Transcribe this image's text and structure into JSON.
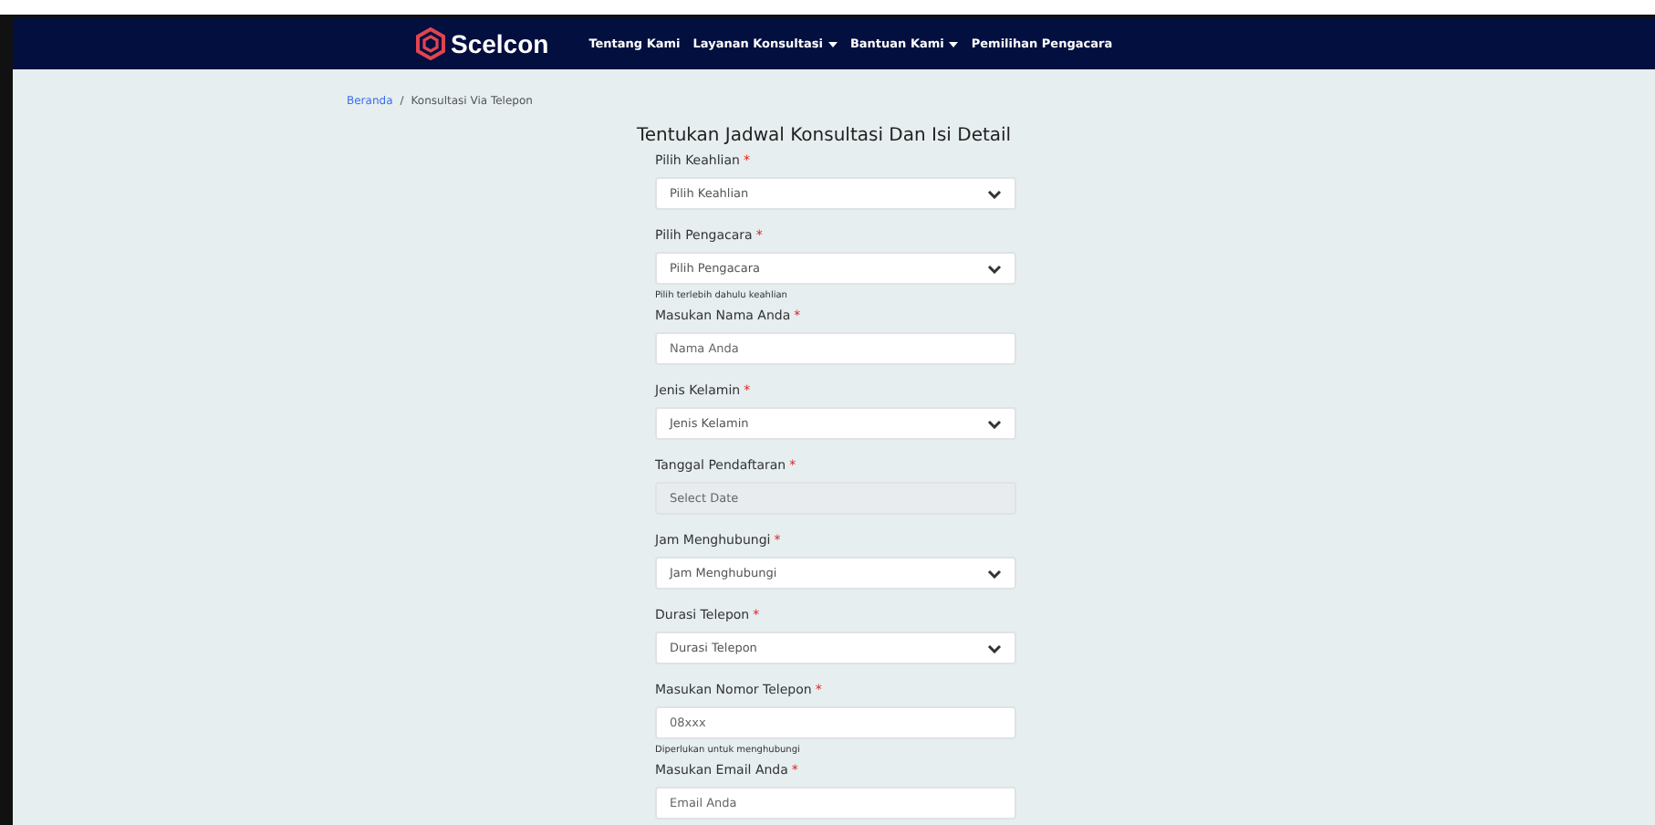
{
  "navbar": {
    "brand": "Scelcon",
    "links": [
      {
        "label": "Tentang Kami",
        "dropdown": false
      },
      {
        "label": "Layanan Konsultasi",
        "dropdown": true
      },
      {
        "label": "Bantuan Kami",
        "dropdown": true
      },
      {
        "label": "Pemilihan Pengacara",
        "dropdown": false
      }
    ]
  },
  "breadcrumb": [
    {
      "label": "Beranda",
      "kind": "link"
    },
    {
      "label": "/",
      "kind": "separator"
    },
    {
      "label": "Konsultasi Via Telepon",
      "kind": "current"
    }
  ],
  "form": {
    "title": "Tentukan Jadwal Konsultasi Dan Isi Detail",
    "fields": [
      {
        "kind": "select",
        "label": "Pilih Keahlian",
        "required": "*",
        "placeholder": "Pilih Keahlian",
        "disabled": false
      },
      {
        "kind": "select",
        "label": "Pilih Pengacara",
        "required": "*",
        "placeholder": "Pilih Pengacara",
        "disabled": false,
        "help": "Pilih terlebih dahulu keahlian"
      },
      {
        "kind": "text",
        "label": "Masukan Nama Anda",
        "required": "*",
        "placeholder": "Nama Anda",
        "disabled": false
      },
      {
        "kind": "select",
        "label": "Jenis Kelamin",
        "required": "*",
        "placeholder": "Jenis Kelamin",
        "disabled": false
      },
      {
        "kind": "text",
        "label": "Tanggal Pendaftaran",
        "required": "*",
        "placeholder": "Select Date",
        "disabled": true
      },
      {
        "kind": "select",
        "label": "Jam Menghubungi",
        "required": "*",
        "placeholder": "Jam Menghubungi",
        "disabled": false
      },
      {
        "kind": "select",
        "label": "Durasi Telepon",
        "required": "*",
        "placeholder": "Durasi Telepon",
        "disabled": false
      },
      {
        "kind": "text",
        "label": "Masukan Nomor Telepon",
        "required": "*",
        "placeholder": "08xxx",
        "disabled": false,
        "help": "Diperlukan untuk menghubungi"
      },
      {
        "kind": "text",
        "label": "Masukan Email Anda",
        "required": "*",
        "placeholder": "Email Anda",
        "disabled": false
      }
    ]
  }
}
